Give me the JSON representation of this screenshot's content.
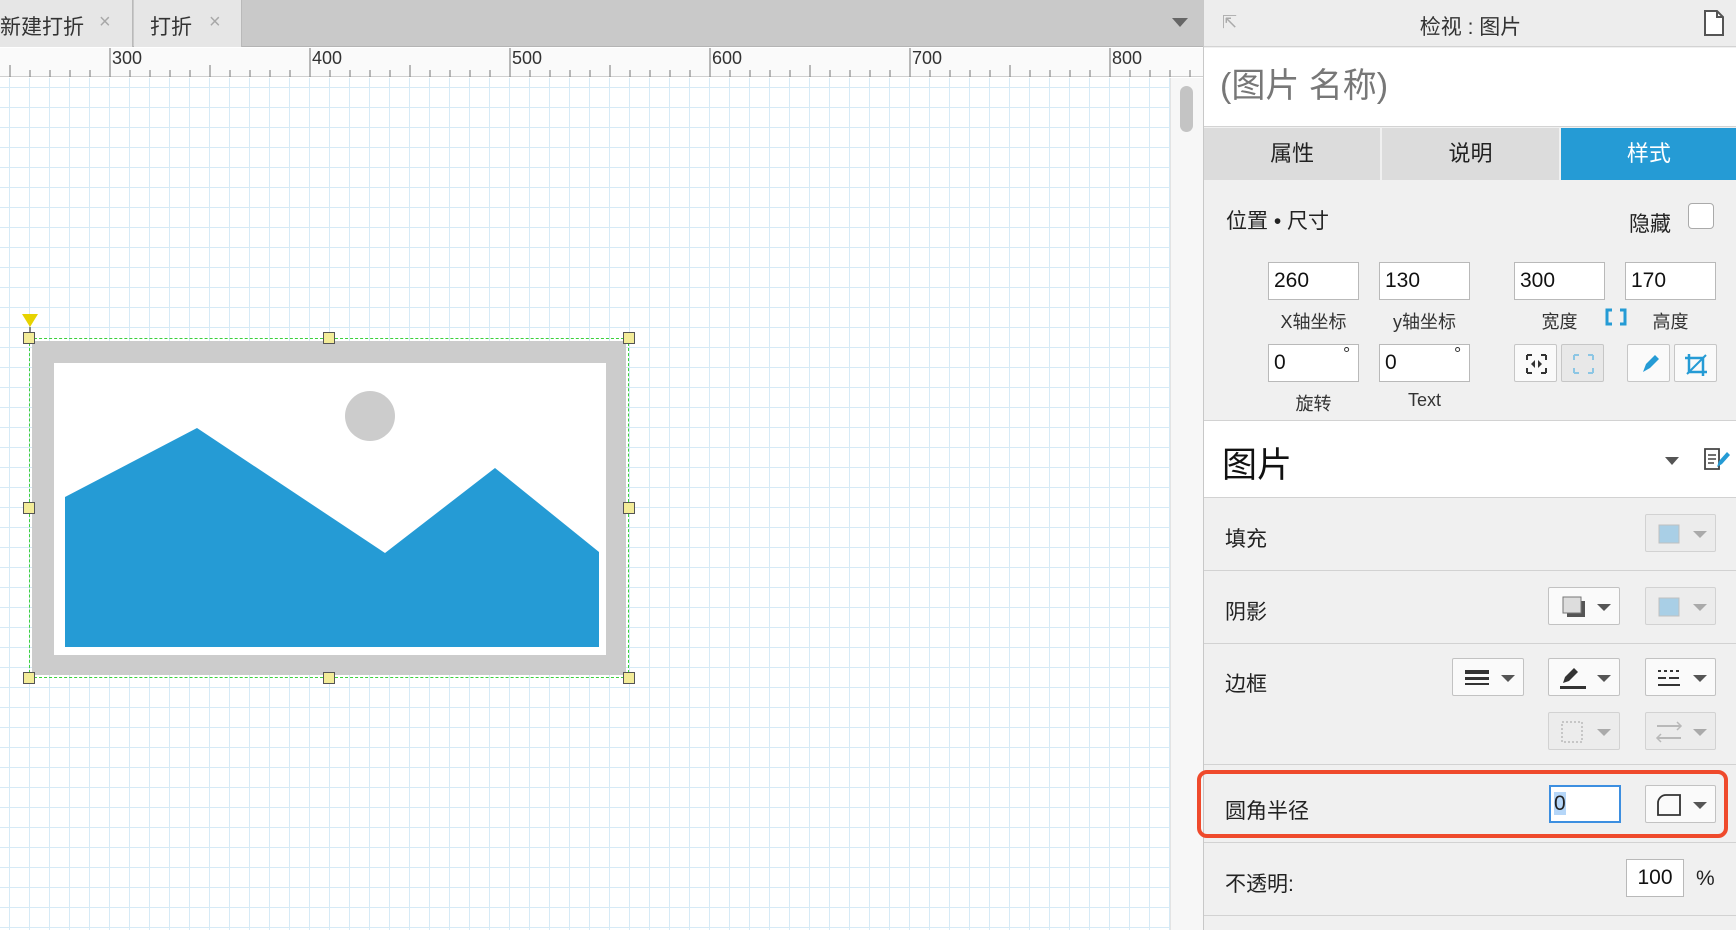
{
  "tabs": [
    {
      "label": "新建打折",
      "close": "×"
    },
    {
      "label": "打折",
      "close": "×"
    }
  ],
  "ruler": {
    "labels": [
      "300",
      "400",
      "500",
      "600",
      "700",
      "800"
    ]
  },
  "inspector": {
    "title": "检视 : 图片",
    "name_placeholder": "(图片 名称)",
    "tabs": [
      "属性",
      "说明",
      "样式"
    ],
    "active_tab": "样式",
    "position_size": {
      "heading": "位置 • 尺寸",
      "hidden_label": "隐藏",
      "x": {
        "value": "260",
        "caption": "X轴坐标"
      },
      "y": {
        "value": "130",
        "caption": "y轴坐标"
      },
      "width": {
        "value": "300",
        "caption": "宽度"
      },
      "height": {
        "value": "170",
        "caption": "高度"
      },
      "rotation": {
        "value": "0",
        "caption": "旋转",
        "unit": "°"
      },
      "text_rotation": {
        "value": "0",
        "caption": "Text",
        "unit": "°"
      }
    },
    "style_name": "图片",
    "fill_label": "填充",
    "shadow_label": "阴影",
    "border_label": "边框",
    "radius": {
      "label": "圆角半径",
      "value": "0"
    },
    "opacity": {
      "label": "不透明:",
      "value": "100",
      "unit": "%"
    }
  },
  "colors": {
    "accent": "#259bd5",
    "mountain": "#259bd5",
    "highlight": "#ef4a2c",
    "selection": "#3bd13b",
    "handle": "#f3ec98"
  }
}
